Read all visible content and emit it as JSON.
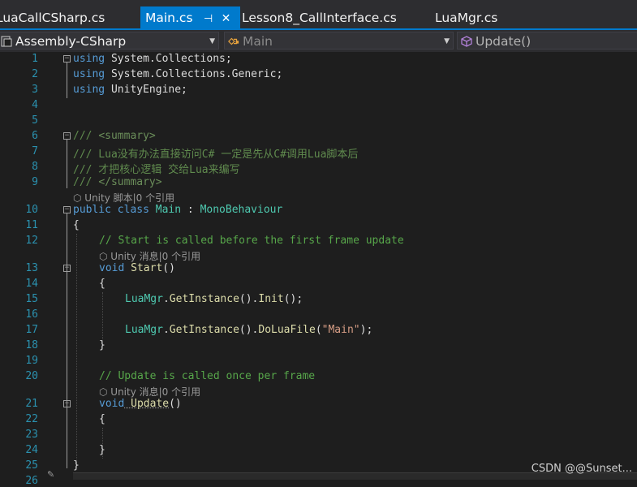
{
  "tabs": [
    {
      "label": "LuaCallCSharp.cs",
      "active": false
    },
    {
      "label": "Main.cs",
      "active": true,
      "pin": "⊣",
      "close": "✕"
    },
    {
      "label": "Lesson8_CallInterface.cs",
      "active": false
    },
    {
      "label": "LuaMgr.cs",
      "active": false
    }
  ],
  "nav": {
    "project": "Assembly-CSharp",
    "class": "Main",
    "member": "Update()"
  },
  "lines": [
    "1",
    "2",
    "3",
    "4",
    "5",
    "6",
    "7",
    "8",
    "9",
    "10",
    "11",
    "12",
    "13",
    "14",
    "15",
    "16",
    "17",
    "18",
    "19",
    "20",
    "21",
    "22",
    "23",
    "24",
    "25",
    "26"
  ],
  "code": {
    "using1_kw": "using",
    "using1_ns": " System.Collections;",
    "using2_kw": "using",
    "using2_ns": " System.Collections.Generic;",
    "using3_kw": "using",
    "using3_ns": " UnityEngine;",
    "doc1_a": "/// ",
    "doc1_b": "<summary>",
    "doc2": "/// Lua没有办法直接访问C# 一定是先从C#调用Lua脚本后",
    "doc3": "/// 才把核心逻辑 交给Lua来编写",
    "doc4_a": "/// ",
    "doc4_b": "</summary>",
    "lens_class": "Unity 脚本|0 个引用",
    "class_public": "public",
    "class_kw": " class",
    "class_name": " Main",
    "class_colon": " : ",
    "class_base": "MonoBehaviour",
    "brace_open": "{",
    "cm_start": "// Start is called before the first frame update",
    "lens_start": "Unity 消息|0 个引用",
    "start_void": "void",
    "start_name": " Start",
    "start_paren": "()",
    "brace_open2": "{",
    "l15_type": "LuaMgr",
    "l15_dot1": ".",
    "l15_m1": "GetInstance",
    "l15_p1": "().",
    "l15_m2": "Init",
    "l15_p2": "();",
    "l17_type": "LuaMgr",
    "l17_dot1": ".",
    "l17_m1": "GetInstance",
    "l17_p1": "().",
    "l17_m2": "DoLuaFile",
    "l17_p2": "(",
    "l17_str": "\"Main\"",
    "l17_p3": ");",
    "brace_close2": "}",
    "cm_update": "// Update is called once per frame",
    "lens_update": "Unity 消息|0 个引用",
    "update_void": "void",
    "update_name": " Update",
    "update_paren": "()",
    "brace_open3": "{",
    "brace_close3": "}",
    "brace_close": "}"
  },
  "watermark": "CSDN @@Sunset..."
}
